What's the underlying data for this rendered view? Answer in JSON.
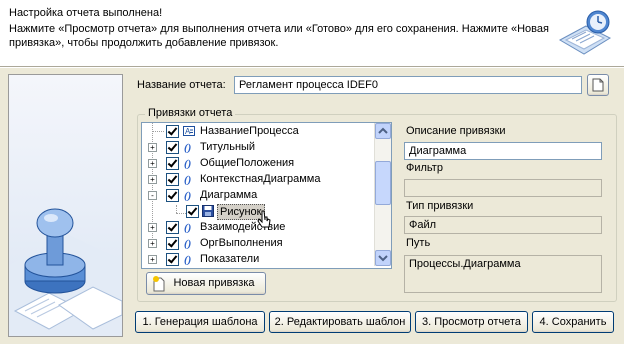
{
  "header": {
    "title": "Настройка отчета выполнена!",
    "description": "Нажмите «Просмотр отчета»  для выполнения отчета или «Готово» для его сохранения. Нажмите «Новая привязка», чтобы продолжить добавление привязок."
  },
  "report_name": {
    "label": "Название отчета:",
    "value": "Регламент процесса IDEF0"
  },
  "bindings_group_title": "Привязки отчета",
  "tree": [
    {
      "label": "НазваниеПроцесса",
      "icon": "text-field-icon",
      "expander": false
    },
    {
      "label": "Титульный",
      "icon": "binding-icon",
      "expander": "+"
    },
    {
      "label": "ОбщиеПоложения",
      "icon": "binding-icon",
      "expander": "+"
    },
    {
      "label": "КонтекстнаяДиаграмма",
      "icon": "binding-icon",
      "expander": "+"
    },
    {
      "label": "Диаграмма",
      "icon": "binding-icon",
      "expander": "-"
    },
    {
      "label": "Рисунок",
      "icon": "save-image-icon",
      "expander": false,
      "selected": true
    },
    {
      "label": "Взаимодействие",
      "icon": "binding-icon",
      "expander": "+"
    },
    {
      "label": "ОргВыполнения",
      "icon": "binding-icon",
      "expander": "+"
    },
    {
      "label": "Показатели",
      "icon": "binding-icon",
      "expander": "+"
    }
  ],
  "details": {
    "description_label": "Описание привязки",
    "description_value": "Диаграмма",
    "filter_label": "Фильтр",
    "filter_value": "",
    "type_label": "Тип привязки",
    "type_value": "Файл",
    "path_label": "Путь",
    "path_value": "Процессы.Диаграмма"
  },
  "new_binding_button": "Новая привязка",
  "footer_buttons": {
    "generate": "1. Генерация шаблона",
    "edit": "2. Редактировать шаблон",
    "preview": "3. Просмотр отчета",
    "save": "4. Сохранить"
  }
}
